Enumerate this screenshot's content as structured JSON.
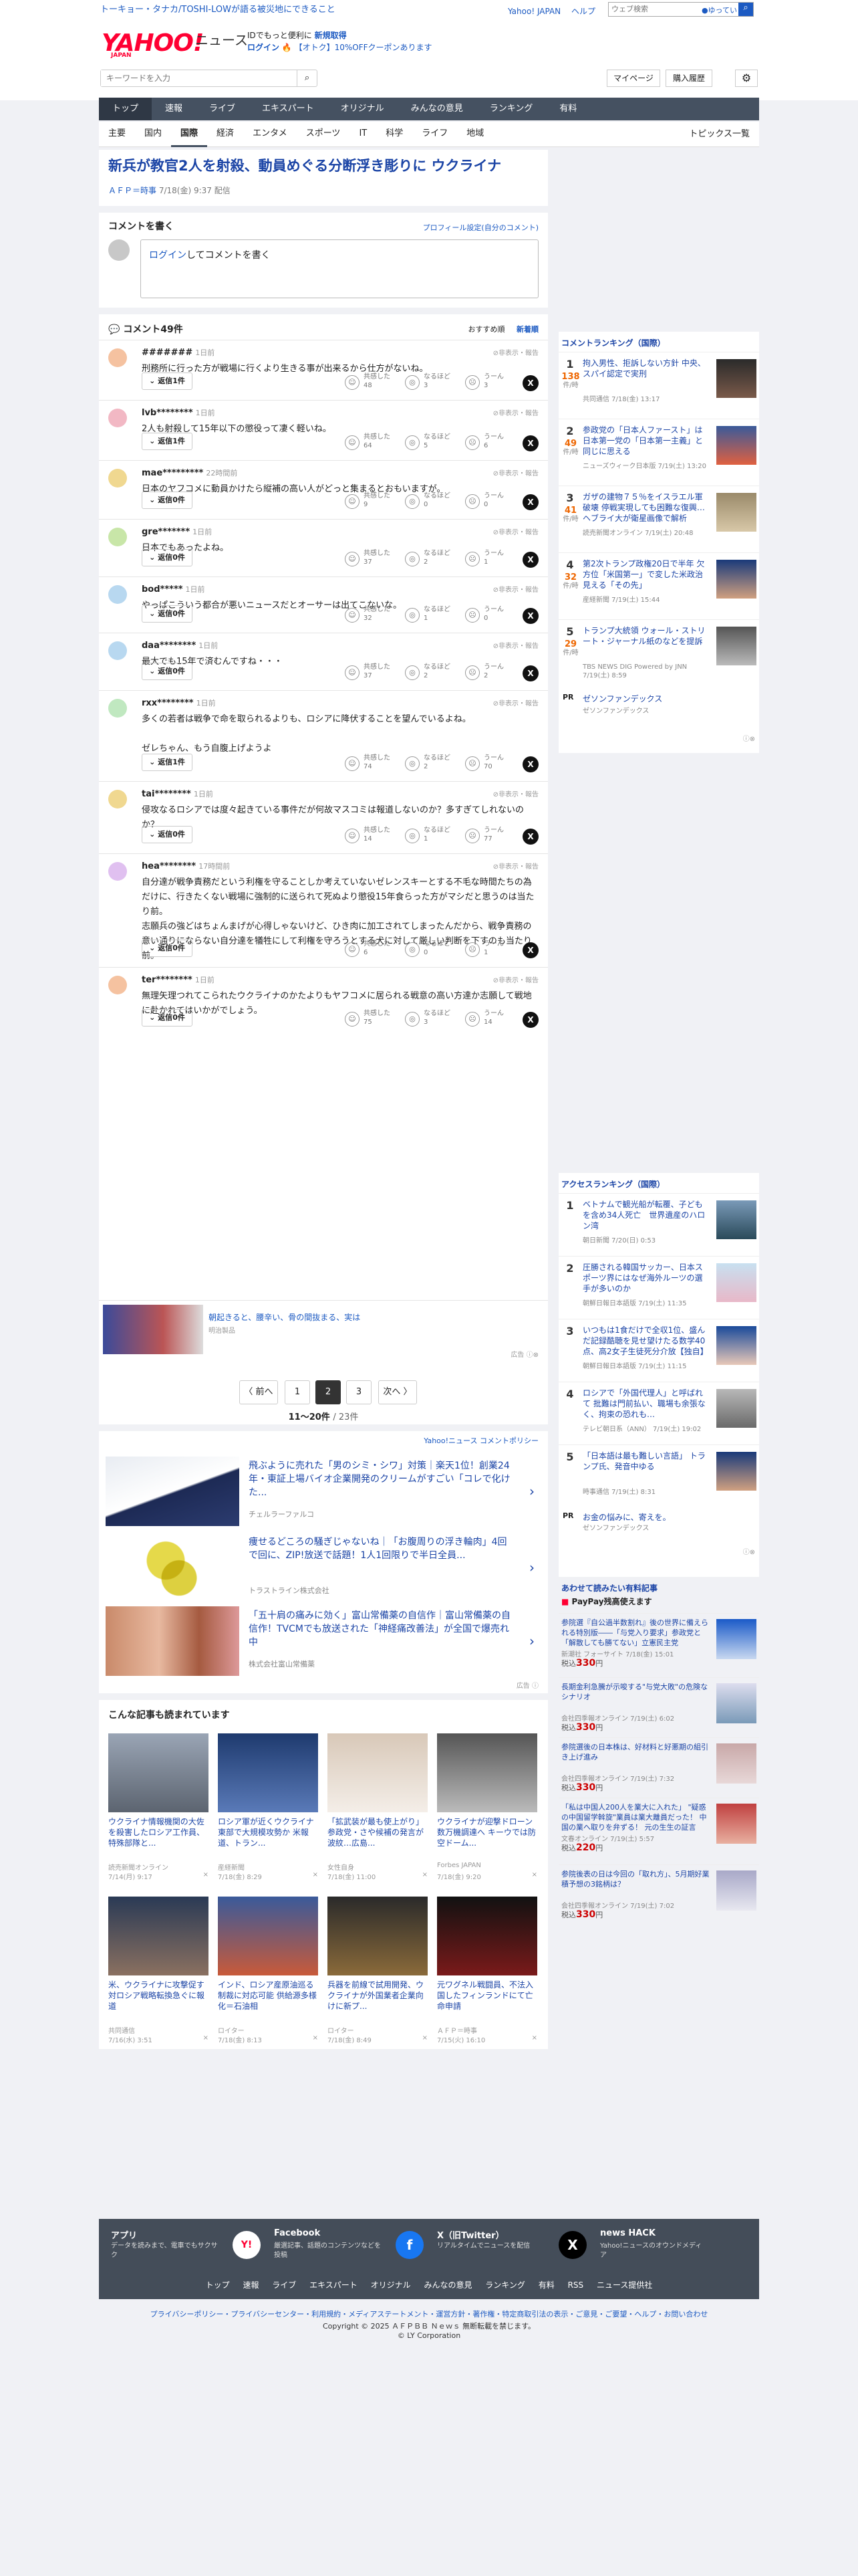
{
  "header": {
    "promo": "トーキョー・タナカ/TOSHI-LOWが語る被災地にできること",
    "logo": "YAHOO!",
    "logo_sub": "JAPAN",
    "news_word": "ニュース",
    "tagline_prefix": "IDでもっと便利に",
    "tagline_new": "新規取得",
    "login_text": "ログイン",
    "coupon_text": "【オトク】10%OFFクーポンあります",
    "top_links": [
      "Yahoo! JAPAN",
      "ヘルプ"
    ],
    "top_search_placeholder": "ウェブ検索",
    "top_search_btn": "●ゆってい",
    "kw_placeholder": "キーワードを入力",
    "mypage": "マイページ",
    "history": "購入履歴"
  },
  "nav": [
    "トップ",
    "速報",
    "ライブ",
    "エキスパート",
    "オリジナル",
    "みんなの意見",
    "ランキング",
    "有料"
  ],
  "subnav": [
    "主要",
    "国内",
    "国際",
    "経済",
    "エンタメ",
    "スポーツ",
    "IT",
    "科学",
    "ライフ",
    "地域"
  ],
  "subnav_right": "トピックス一覧",
  "article": {
    "headline": "新兵が教官2人を射殺、動員めぐる分断浮き彫りに ウクライナ",
    "source": "ＡＦＰ＝時事",
    "date": "7/18(金) 9:37 配信",
    "comment_write": "コメントを書く",
    "profile_link": "プロフィール設定(自分のコメント)",
    "login_prompt_link": "ログイン",
    "login_prompt_rest": "してコメントを書く",
    "comment_count": "コメント49件",
    "sort_recommend": "おすすめ順",
    "sort_new": "新着順"
  },
  "action_labels": {
    "agree": "共感した",
    "naruhodo": "なるほど",
    "hmm": "うーん",
    "report": "非表示・報告",
    "reply_prefix": "返信"
  },
  "comments": [
    {
      "user": "#######",
      "ago": "1日前",
      "body": "刑務所に行った方が戦場に行くより生きる事が出来るから仕方がないね。",
      "replies": "1件",
      "agree": "48",
      "naruhodo": "3",
      "hmm": "3"
    },
    {
      "user": "lvb********",
      "ago": "1日前",
      "body": "2人も射殺して15年以下の懲役って凄く軽いね。",
      "replies": "1件",
      "agree": "64",
      "naruhodo": "5",
      "hmm": "6"
    },
    {
      "user": "mae*********",
      "ago": "22時間前",
      "body": "日本のヤフコメに動員かけたら縦補の高い人がどっと集まるとおもいますが。",
      "replies": "0件",
      "agree": "9",
      "naruhodo": "0",
      "hmm": "0"
    },
    {
      "user": "gre*******",
      "ago": "1日前",
      "body": "日本でもあったよね。",
      "replies": "0件",
      "agree": "37",
      "naruhodo": "2",
      "hmm": "1"
    },
    {
      "user": "bod*****",
      "ago": "1日前",
      "body": "やっぱこういう都合が悪いニュースだとオーサーは出てこないな。",
      "replies": "0件",
      "agree": "32",
      "naruhodo": "1",
      "hmm": "0"
    },
    {
      "user": "daa********",
      "ago": "1日前",
      "body": "最大でも15年で済むんですね・・・",
      "replies": "0件",
      "agree": "37",
      "naruhodo": "2",
      "hmm": "2"
    },
    {
      "user": "rxx********",
      "ago": "1日前",
      "body": "多くの若者は戦争で命を取られるよりも、ロシアに降伏することを望んでいるよね。\n\nゼレちゃん、もう自腹上げようよ",
      "replies": "1件",
      "agree": "74",
      "naruhodo": "2",
      "hmm": "70"
    },
    {
      "user": "tai********",
      "ago": "1日前",
      "body": "侵攻なるロシアでは度々起きている事件だが何故マスコミは報道しないのか？多すぎてしれないのか？",
      "replies": "0件",
      "agree": "14",
      "naruhodo": "1",
      "hmm": "77"
    },
    {
      "user": "hea********",
      "ago": "17時間前",
      "body": "自分達が戦争責務だという利権を守ることしか考えていないゼレンスキーとする不毛な時間たちの為だけに、行きたくない戦場に強制的に送られて死ぬより懲役15年食らった方がマシだと思うのは当たり前。\n志願兵の強どはちょんまげが心得しゃないけど、ひき肉に加工されてしまったんだから、戦争責務の意い通りにならない自分達を犠牲にして利権を守ろうとする犬に対して厳しい判断を下すのも当たり前。",
      "replies": "0件",
      "agree": "6",
      "naruhodo": "0",
      "hmm": "1"
    },
    {
      "user": "ter********",
      "ago": "1日前",
      "body": "無理矢理つれてこられたウクライナのかたよりもヤフコメに居られる戦意の高い方達か志願して戦地に赴かれてはいかがでしょう。",
      "replies": "0件",
      "agree": "75",
      "naruhodo": "3",
      "hmm": "14"
    }
  ],
  "ad_banner": {
    "title": "朝起きると、腰辛い、骨の間抜まる、実は",
    "src": "明治製品",
    "mark": "広告"
  },
  "pager": {
    "prev": "〈 前へ",
    "pages": [
      "1",
      "2",
      "3"
    ],
    "current": "2",
    "next": "次へ 〉",
    "info": "11〜20件",
    "total": "/ 23件"
  },
  "policy": "Yahoo!ニュース コメントポリシー",
  "ad_list": [
    {
      "title": "飛ぶように売れた「男のシミ・シワ」対策｜楽天1位！創業24年・東証上場バイオ企業開発のクリームがすごい「コレで化けた...",
      "sponsor": "チェルラーファルコ"
    },
    {
      "title": "痩せるどころの騒ぎじゃないね｜「お腹周りの浮き輪肉」4回で回に、ZIP!放送で話題！1人1回限りで半日全員...",
      "sponsor": "トラストライン株式会社"
    },
    {
      "title": "「五十肩の痛みに効く」富山常備薬の自信作｜富山常備薬の自信作！TVCMでも放送された「神経痛改善法」が全国で爆売れ中",
      "sponsor": "株式会社富山常備薬"
    }
  ],
  "ad_list_mark": "広告",
  "read_title": "こんな記事も読まれています",
  "read_cards": [
    {
      "title": "ウクライナ情報機関の大佐を殺害したロシア工作員、特殊部隊と...",
      "src": "読売新聞オンライン",
      "date": "7/14(月) 9:17"
    },
    {
      "title": "ロシア軍が近くウクライナ東部で大規模攻勢か 米報道、トラン...",
      "src": "産経新聞",
      "date": "7/18(金) 8:29"
    },
    {
      "title": "「拡武装が最も使上がり」参政党・さや候補の発言が波紋…広島...",
      "src": "女性自身",
      "date": "7/18(金) 11:00"
    },
    {
      "title": "ウクライナが迎撃ドローン数万機調達へ キーウでは防空ドーム...",
      "src": "Forbes JAPAN",
      "date": "7/18(金) 9:20"
    },
    {
      "title": "米、ウクライナに攻撃促す 対ロシア戦略転換急ぐに報道",
      "src": "共同通信",
      "date": "7/16(水) 3:51"
    },
    {
      "title": "インド、ロシア産原油巡る制裁に対応可能 供給源多様化＝石油相",
      "src": "ロイター",
      "date": "7/18(金) 8:13"
    },
    {
      "title": "兵器を前線で試用開発、ウクライナが外国業者企業向けに新プ...",
      "src": "ロイター",
      "date": "7/18(金) 8:49"
    },
    {
      "title": "元ワグネル戦闘員、不法入国したフィンランドにて亡命申請",
      "src": "ＡＦＰ＝時事",
      "date": "7/15(火) 16:10"
    }
  ],
  "ranking_title": "コメントランキング（国際）",
  "comment_ranking": [
    {
      "n": "1",
      "count": "138",
      "title": "拘入男性、拒訴しない方針 中央、スパイ認定で実刑",
      "src": "共同通信 7/18(金) 13:17"
    },
    {
      "n": "2",
      "count": "49",
      "title": "参政党の「日本人ファースト」は日本第一党の「日本第一主義」と同じに思える",
      "src": "ニューズウィーク日本版 7/19(土) 13:20"
    },
    {
      "n": "3",
      "count": "41",
      "title": "ガザの建物７５％をイスラエル軍破壊 停戦実現しても困難な復興…ヘブライ大が衛星画像で解析",
      "src": "読売新聞オンライン 7/19(土) 20:48"
    },
    {
      "n": "4",
      "count": "32",
      "title": "第2次トランプ政権20日で半年 欠方位「米国第一」で変した米政治 見える「その先」",
      "src": "産経新聞 7/19(土) 15:44"
    },
    {
      "n": "5",
      "count": "29",
      "title": "トランプ大統領 ウォール・ストリート・ジャーナル紙のなどを提訴",
      "src": "TBS NEWS DIG Powered by JNN 7/19(土) 8:59"
    }
  ],
  "count_unit": "件/時",
  "pr1": {
    "label": "PR",
    "title": "ゼソンファンデックス",
    "src": "ゼソンファンデックス"
  },
  "access_title": "アクセスランキング（国際）",
  "access_ranking": [
    {
      "n": "1",
      "title": "ベトナムで観光船が転覆、子どもを含め34人死亡　世界遺産のハロン湾",
      "src": "朝日新聞 7/20(日) 0:53"
    },
    {
      "n": "2",
      "title": "圧勝される韓国サッカー、日本スポーツ界にはなぜ海外ルーツの選手が多いのか",
      "src": "朝鮮日報日本語版 7/19(土) 11:35"
    },
    {
      "n": "3",
      "title": "いつもは1食だけで全収1位、盛んだ記録酷聴を見せ望けたる数学40点、高2女子生徒死分介放【独自】",
      "src": "朝鮮日報日本語版 7/19(土) 11:15"
    },
    {
      "n": "4",
      "title": "ロシアで「外国代理人」と呼ばれて 批難は門前払い、職場も余張なく、拘束の恐れも…",
      "src": "テレビ朝日系（ANN） 7/19(土) 19:02"
    },
    {
      "n": "5",
      "title": "「日本語は最も難しい言語」 トランプ氏、発音中ゆる",
      "src": "時事通信 7/19(土) 8:31"
    }
  ],
  "pr2": {
    "label": "PR",
    "title": "お金の悩みに、寄えを。",
    "src": "ゼソンファンデックス"
  },
  "shopping_title": "あわせて読みたい有料記事",
  "paypay": "PayPay残高使えます",
  "shopping": [
    {
      "title": "参院選『自公過半数割れ』後の世界に備えられる特別版――「与党入り要求」参政党と「解散しても勝てない」立憲民主党",
      "src": "新潮社 フォーサイト 7/18(金) 15:01",
      "price": "330"
    },
    {
      "title": "長期金利急騰が示唆する\"与党大敗\"の危険なシナリオ",
      "src": "会社四季報オンライン 7/19(土) 6:02",
      "price": "330"
    },
    {
      "title": "参院選後の日本株は、好材料と好悪期の組引き上げ進み",
      "src": "会社四季報オンライン 7/19(土) 7:32",
      "price": "330"
    },
    {
      "title": "「私は中国人200人を業大に入れた」 \"疑惑の中国留学斡旋\"業員は業大離員だった！ 中国の業へ取りを弁ずる！ 元の生生の証言",
      "src": "文春オンライン 7/19(土) 5:57",
      "price": "220"
    },
    {
      "title": "参院後表の日は今回の「取れ方」、5月期好業積予想の3銘柄は？",
      "src": "会社四季報オンライン 7/19(土) 7:02",
      "price": "330"
    }
  ],
  "price_prefix": "税込",
  "price_unit": "円",
  "footer": {
    "blocks": [
      {
        "title": "アプリ",
        "desc": "データを読みまで、電車でもサクサク",
        "icon": "Y!"
      },
      {
        "title": "Facebook",
        "desc": "厳選記事、話題のコンテンツなどを投稿",
        "icon": "f"
      },
      {
        "title": "X（旧Twitter）",
        "desc": "リアルタイムでニュースを配信",
        "icon": "X"
      },
      {
        "title": "news HACK",
        "desc": "Yahoo!ニュースのオウンドメディア",
        "icon": "N"
      }
    ],
    "nav": [
      "トップ",
      "速報",
      "ライブ",
      "エキスパート",
      "オリジナル",
      "みんなの意見",
      "ランキング",
      "有料",
      "RSS",
      "ニュース提供社"
    ],
    "links": "プライバシーポリシー・プライバシーセンター・利用規約・メディアステートメント・運営方針・著作権・特定商取引法の表示・ご意見・ご要望・ヘルプ・お問い合わせ",
    "copy1": "Copyright © 2025 ＡＦＰＢＢ Ｎｅｗｓ 無断転載を禁じます。",
    "copy2": "© LY Corporation"
  }
}
